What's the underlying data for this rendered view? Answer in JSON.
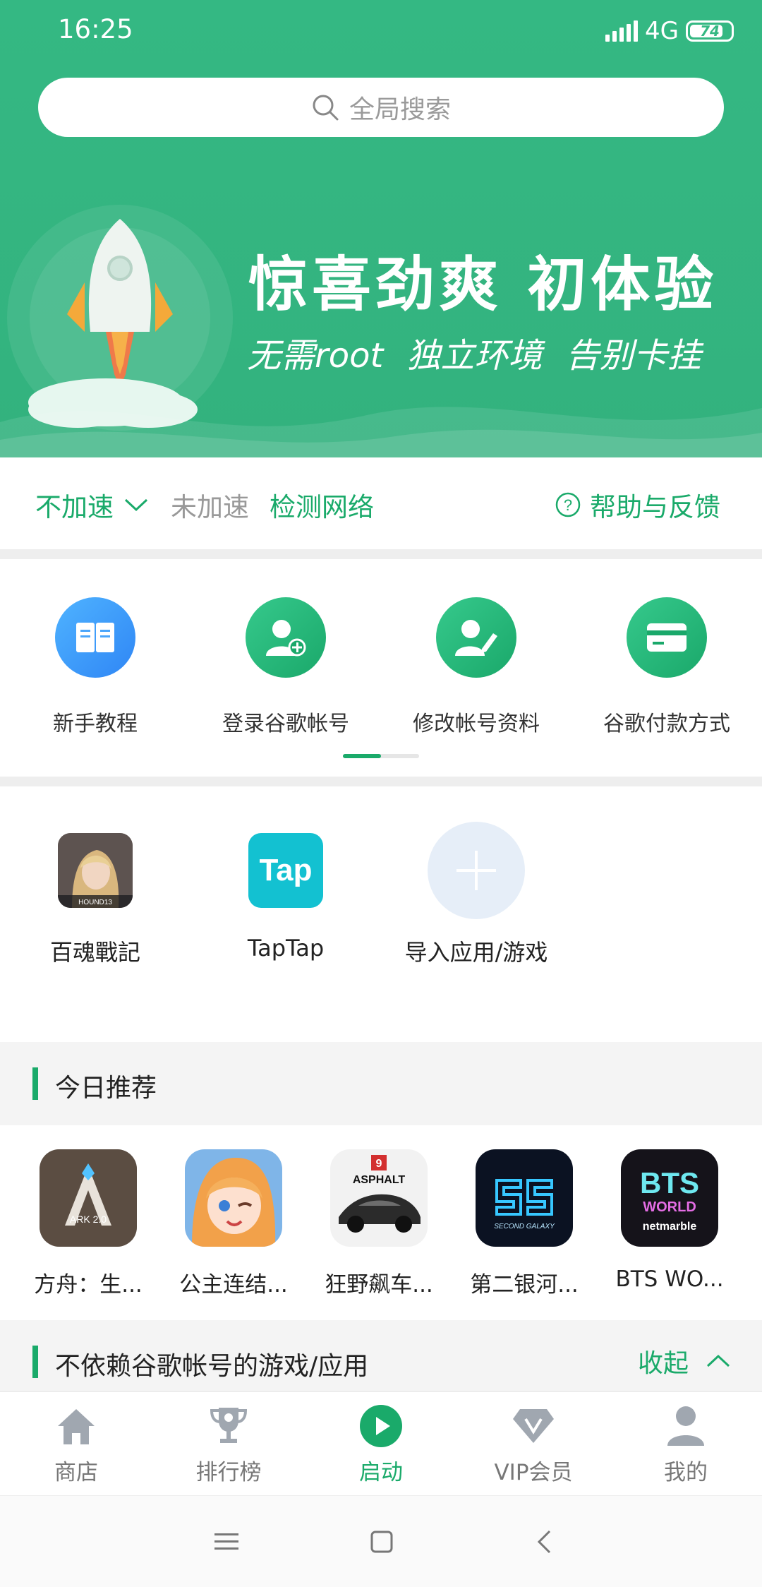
{
  "status_bar": {
    "time": "16:25",
    "network": "4G",
    "battery": "74"
  },
  "search": {
    "placeholder": "全局搜索"
  },
  "banner": {
    "title": "惊喜劲爽 初体验",
    "subtitle": "无需root 独立环境 告别卡挂"
  },
  "accel": {
    "mode_label": "不加速",
    "state_label": "未加速",
    "detect_label": "检测网络",
    "help_label": "帮助与反馈"
  },
  "quick_actions": [
    {
      "label": "新手教程",
      "icon": "book-icon"
    },
    {
      "label": "登录谷歌帐号",
      "icon": "add-user-icon"
    },
    {
      "label": "修改帐号资料",
      "icon": "edit-user-icon"
    },
    {
      "label": "谷歌付款方式",
      "icon": "card-icon"
    }
  ],
  "quick_pager": {
    "pages": 2,
    "current": 1
  },
  "apps": [
    {
      "label": "百魂戰記",
      "icon": "hound13-game-icon",
      "icon_text": "HOUND13"
    },
    {
      "label": "TapTap",
      "icon": "taptap-icon",
      "icon_text": "Tap"
    },
    {
      "label": "导入应用/游戏",
      "icon": "add-icon"
    }
  ],
  "sections": {
    "today": {
      "title": "今日推荐"
    },
    "no_google": {
      "title": "不依赖谷歌帐号的游戏/应用",
      "action": "收起"
    }
  },
  "recommendations": [
    {
      "label": "方舟：生...",
      "icon": "ark-game-icon",
      "icon_text": "ARK 2.0"
    },
    {
      "label": "公主连结...",
      "icon": "princess-connect-icon"
    },
    {
      "label": "狂野飙车...",
      "icon": "asphalt-icon",
      "icon_text": "ASPHALT",
      "badge": "9"
    },
    {
      "label": "第二银河...",
      "icon": "second-galaxy-icon",
      "icon_text": "SECOND GALAXY"
    },
    {
      "label": "BTS WO...",
      "icon": "bts-world-icon",
      "icon_text": "BTS",
      "icon_text2": "WORLD",
      "icon_text3": "netmarble"
    }
  ],
  "bottom_nav": [
    {
      "label": "商店",
      "icon": "home-icon",
      "active": false
    },
    {
      "label": "排行榜",
      "icon": "trophy-icon",
      "active": false
    },
    {
      "label": "启动",
      "icon": "play-icon",
      "active": true
    },
    {
      "label": "VIP会员",
      "icon": "diamond-icon",
      "active": false
    },
    {
      "label": "我的",
      "icon": "person-icon",
      "active": false
    }
  ],
  "colors": {
    "brand_green": "#1aaa6a",
    "header_green": "#34b883",
    "inactive": "#777777"
  }
}
